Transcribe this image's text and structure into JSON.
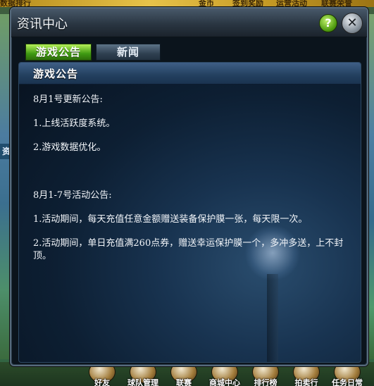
{
  "background": {
    "top_strip_texts": [
      "数据排行",
      "金币",
      "签到奖励",
      "运营活动",
      "联赛荣誉"
    ],
    "left_label": "资",
    "dock": [
      {
        "label": "好友"
      },
      {
        "label": "球队管理"
      },
      {
        "label": "联赛"
      },
      {
        "label": "商城中心"
      },
      {
        "label": "排行榜"
      },
      {
        "label": "拍卖行"
      },
      {
        "label": "任务日常"
      }
    ]
  },
  "dialog": {
    "title": "资讯中心",
    "help_label": "?",
    "close_label": "✕",
    "tabs": [
      {
        "label": "游戏公告",
        "active": true
      },
      {
        "label": "新闻",
        "active": false
      }
    ],
    "section_title": "游戏公告",
    "announcements": [
      "8月1号更新公告:",
      "1.上线活跃度系统。",
      "2.游戏数据优化。",
      "8月1-7号活动公告:",
      "1.活动期间，每天充值任意金额赠送装备保护膜一张，每天限一次。",
      "2.活动期间，单日充值满260点券，赠送幸运保护膜一个，多冲多送，上不封顶。"
    ]
  },
  "colors": {
    "active_tab": "#3f9a12",
    "panel_bg": "#0d1f33",
    "text": "#f3f6fa"
  }
}
